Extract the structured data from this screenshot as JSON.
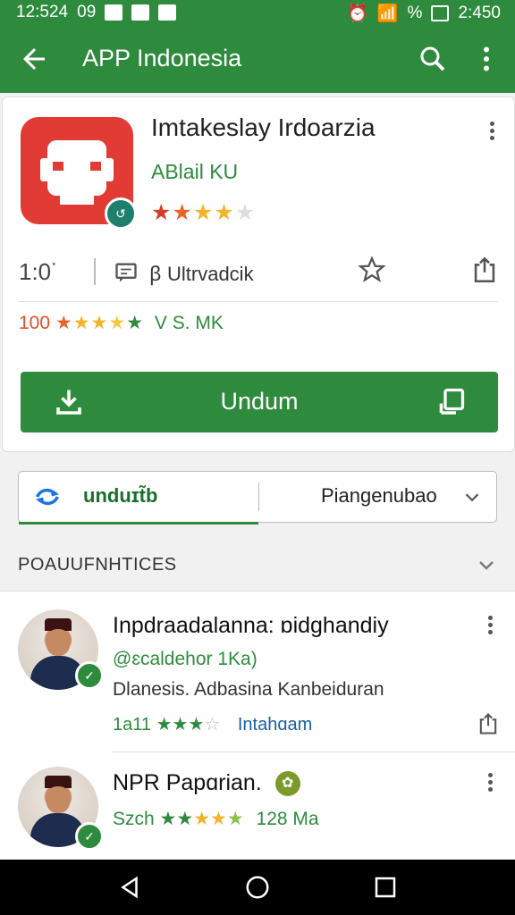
{
  "status_bar": {
    "time": "12:524",
    "icons_left": "09",
    "battery": "%",
    "time_right": "2:450"
  },
  "app_bar": {
    "title": "APP Indonesia"
  },
  "app": {
    "title": "Imtakeslay Irdoarzia",
    "developer": "ABlail KU",
    "rating_stars": "★★★★★",
    "size": "1:0˙",
    "stat_text": "ꞵ Ultrvadcik",
    "rating_count": "100",
    "rating_text": "V S. MK",
    "download_label": "Undum"
  },
  "toggle": {
    "left_label": "unduɪt̃b",
    "right_label": "Piangenubao"
  },
  "section": {
    "title": "POAUUFNHTICES"
  },
  "items": [
    {
      "name": "Inpdraadalanna: ɒidghandiy",
      "sub": "@ɛcaldehor 1Ka)",
      "desc": "Dlanesis. Adbasina Kanbeiduran",
      "rating": "1a11",
      "link": "Intahɑam"
    },
    {
      "name": "NPR Papɑrian.",
      "sub": "Szch",
      "rating_value": "128 Ma"
    }
  ],
  "colors": {
    "primary": "#2e8b3d",
    "app_icon": "#e23b35"
  }
}
